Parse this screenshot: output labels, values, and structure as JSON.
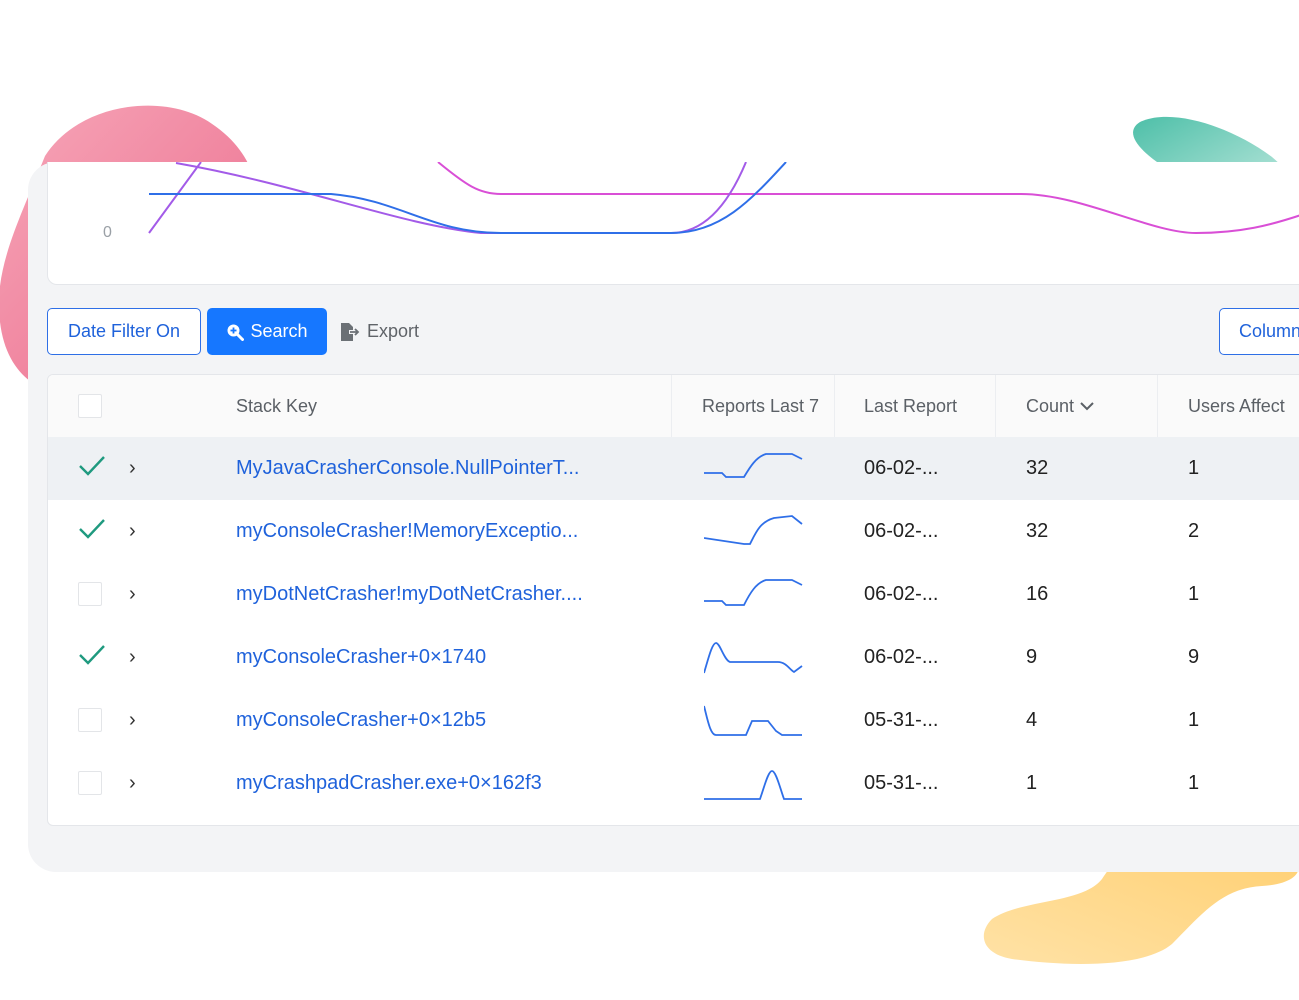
{
  "chart": {
    "y_tick": "0"
  },
  "toolbar": {
    "date_filter_label": "Date Filter On",
    "search_label": "Search",
    "export_label": "Export",
    "columns_label": "Column"
  },
  "table": {
    "headers": {
      "stack_key": "Stack Key",
      "reports_last_7": "Reports Last 7",
      "last_report": "Last Report",
      "count": "Count",
      "users_affected": "Users Affect"
    },
    "rows": [
      {
        "checked": true,
        "stack_key": "MyJavaCrasherConsole.NullPointerT...",
        "last_report": "06-02-...",
        "count": "32",
        "users": "1"
      },
      {
        "checked": true,
        "stack_key": "myConsoleCrasher!MemoryExceptio...",
        "last_report": "06-02-...",
        "count": "32",
        "users": "2"
      },
      {
        "checked": false,
        "stack_key": "myDotNetCrasher!myDotNetCrasher....",
        "last_report": "06-02-...",
        "count": "16",
        "users": "1"
      },
      {
        "checked": true,
        "stack_key": "myConsoleCrasher+0×1740",
        "last_report": "06-02-...",
        "count": "9",
        "users": "9"
      },
      {
        "checked": false,
        "stack_key": "myConsoleCrasher+0×12b5",
        "last_report": "05-31-...",
        "count": "4",
        "users": "1"
      },
      {
        "checked": false,
        "stack_key": "myCrashpadCrasher.exe+0×162f3",
        "last_report": "05-31-...",
        "count": "1",
        "users": "1"
      }
    ]
  },
  "colors": {
    "accent": "#1677ff",
    "link": "#1f62db",
    "check": "#1f9a7f",
    "line_blue": "#2f6fe8",
    "line_purple": "#a35be8",
    "line_magenta": "#d94fd6"
  }
}
